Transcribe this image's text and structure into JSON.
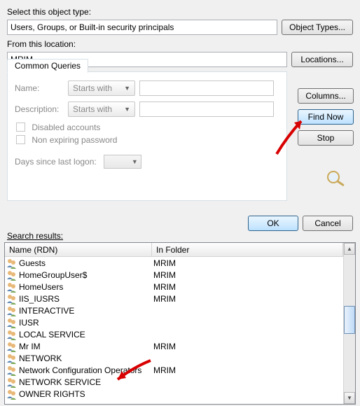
{
  "labels": {
    "select_type": "Select this object type:",
    "from_location": "From this location:",
    "search_results": "Search results:"
  },
  "object_type_value": "Users, Groups, or Built-in security principals",
  "location_value": "MRIM",
  "buttons": {
    "object_types": "Object Types...",
    "locations": "Locations...",
    "columns": "Columns...",
    "find_now": "Find Now",
    "stop": "Stop",
    "ok": "OK",
    "cancel": "Cancel"
  },
  "tab_label": "Common Queries",
  "query": {
    "name_label": "Name:",
    "desc_label": "Description:",
    "starts_with": "Starts with",
    "disabled_accounts": "Disabled accounts",
    "non_expiring": "Non expiring password",
    "days_logon": "Days since last logon:"
  },
  "headers": {
    "c1": "Name (RDN)",
    "c2": "In Folder"
  },
  "rows": [
    {
      "name": "Guests",
      "folder": "MRIM"
    },
    {
      "name": "HomeGroupUser$",
      "folder": "MRIM"
    },
    {
      "name": "HomeUsers",
      "folder": "MRIM"
    },
    {
      "name": "IIS_IUSRS",
      "folder": "MRIM"
    },
    {
      "name": "INTERACTIVE",
      "folder": ""
    },
    {
      "name": "IUSR",
      "folder": ""
    },
    {
      "name": "LOCAL SERVICE",
      "folder": ""
    },
    {
      "name": "Mr IM",
      "folder": "MRIM"
    },
    {
      "name": "NETWORK",
      "folder": ""
    },
    {
      "name": "Network Configuration Operators",
      "folder": "MRIM"
    },
    {
      "name": "NETWORK SERVICE",
      "folder": ""
    },
    {
      "name": "OWNER RIGHTS",
      "folder": ""
    }
  ]
}
